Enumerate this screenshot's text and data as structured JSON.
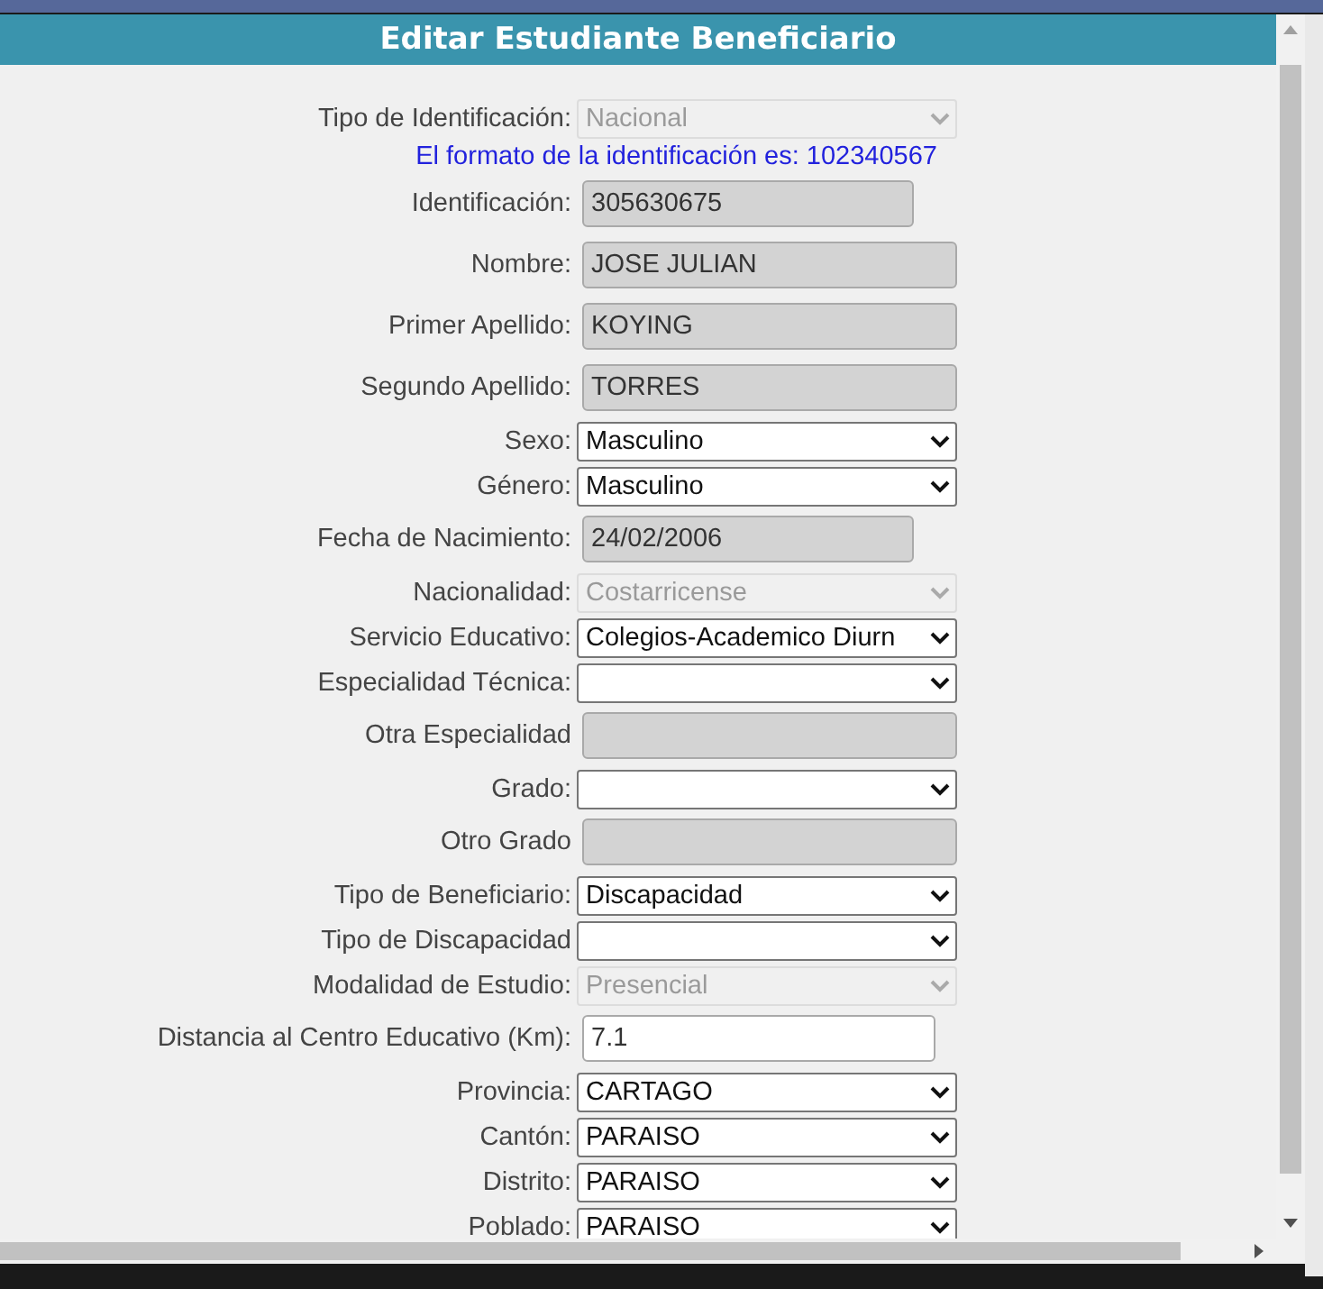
{
  "dialog": {
    "title": "Editar Estudiante Beneficiario"
  },
  "fields": [
    {
      "kind": "select",
      "label": "Tipo de Identificación:",
      "value": "Nacional",
      "disabled": true
    },
    {
      "kind": "note",
      "text": "El formato de la identificación es: 102340567"
    },
    {
      "kind": "text",
      "label": "Identificación:",
      "value": "305630675",
      "readonly": true,
      "short": true
    },
    {
      "kind": "text",
      "label": "Nombre:",
      "value": "JOSE JULIAN",
      "readonly": true,
      "short": false
    },
    {
      "kind": "text",
      "label": "Primer Apellido:",
      "value": "KOYING",
      "readonly": true,
      "short": false
    },
    {
      "kind": "text",
      "label": "Segundo Apellido:",
      "value": "TORRES",
      "readonly": true,
      "short": false
    },
    {
      "kind": "select",
      "label": "Sexo:",
      "value": "Masculino",
      "disabled": false
    },
    {
      "kind": "select",
      "label": "Género:",
      "value": "Masculino",
      "disabled": false
    },
    {
      "kind": "text",
      "label": "Fecha de Nacimiento:",
      "value": "24/02/2006",
      "readonly": true,
      "short": true
    },
    {
      "kind": "select",
      "label": "Nacionalidad:",
      "value": "Costarricense",
      "disabled": true
    },
    {
      "kind": "select",
      "label": "Servicio Educativo:",
      "value": "Colegios-Academico Diurn",
      "disabled": false
    },
    {
      "kind": "select",
      "label": "Especialidad Técnica:",
      "disabled": false
    },
    {
      "kind": "text",
      "label": "Otra Especialidad",
      "readonly": true,
      "short": false
    },
    {
      "kind": "select",
      "label": "Grado:",
      "disabled": false
    },
    {
      "kind": "text",
      "label": "Otro Grado",
      "readonly": true,
      "short": false
    },
    {
      "kind": "select",
      "label": "Tipo de Beneficiario:",
      "value": "Discapacidad",
      "disabled": false
    },
    {
      "kind": "select",
      "label": "Tipo de Discapacidad",
      "disabled": false
    },
    {
      "kind": "select",
      "label": "Modalidad de Estudio:",
      "value": "Presencial",
      "disabled": true
    },
    {
      "kind": "text",
      "label": "Distancia al Centro Educativo (Km):",
      "value": "7.1",
      "readonly": false,
      "short": true
    },
    {
      "kind": "select",
      "label": "Provincia:",
      "value": "CARTAGO",
      "disabled": false
    },
    {
      "kind": "select",
      "label": "Cantón:",
      "value": "PARAISO",
      "disabled": false
    },
    {
      "kind": "select",
      "label": "Distrito:",
      "value": "PARAISO",
      "disabled": false
    },
    {
      "kind": "select",
      "label": "Poblado:",
      "value": "PARAISO",
      "disabled": false
    }
  ]
}
